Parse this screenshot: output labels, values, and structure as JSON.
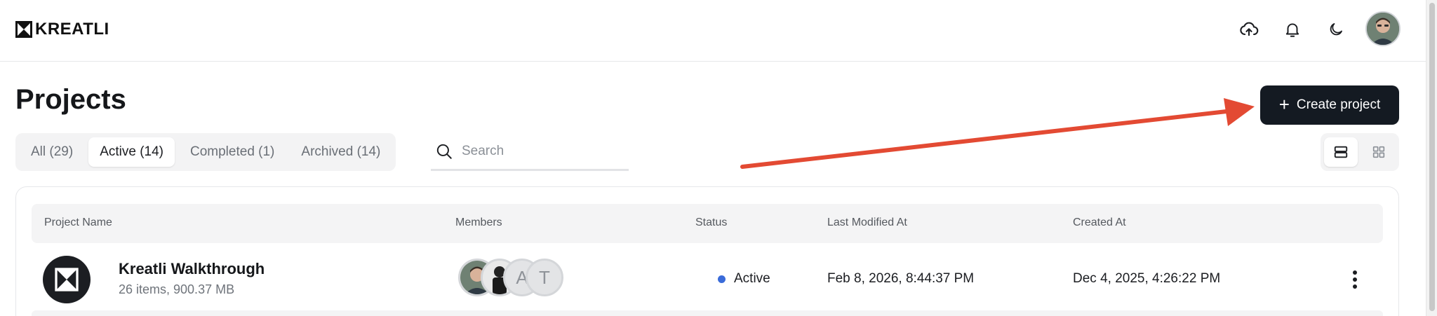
{
  "header": {
    "logo_text": "KREATLI",
    "icons": [
      "upload-cloud-icon",
      "bell-icon",
      "moon-icon"
    ],
    "avatar": "user-avatar"
  },
  "page": {
    "title": "Projects"
  },
  "actions": {
    "create_label": "Create project"
  },
  "tabs": [
    {
      "label": "All (29)",
      "active": false
    },
    {
      "label": "Active (14)",
      "active": true
    },
    {
      "label": "Completed (1)",
      "active": false
    },
    {
      "label": "Archived (14)",
      "active": false
    }
  ],
  "search": {
    "placeholder": "Search"
  },
  "view_toggle": {
    "options": [
      "list-view-icon",
      "grid-view-icon"
    ],
    "active": "list-view-icon"
  },
  "table": {
    "columns": [
      "Project Name",
      "Members",
      "Status",
      "Last Modified At",
      "Created At"
    ],
    "rows": [
      {
        "name": "Kreatli Walkthrough",
        "meta": "26 items, 900.37 MB",
        "members": [
          "photo",
          "photo",
          "A",
          "T"
        ],
        "status": "Active",
        "last_modified": "Feb 8, 2026, 8:44:37 PM",
        "created": "Dec 4, 2025, 4:26:22 PM"
      }
    ]
  },
  "colors": {
    "primary_button": "#141a22",
    "status_active": "#3a6bd9",
    "annotation_arrow": "#e34a33"
  }
}
